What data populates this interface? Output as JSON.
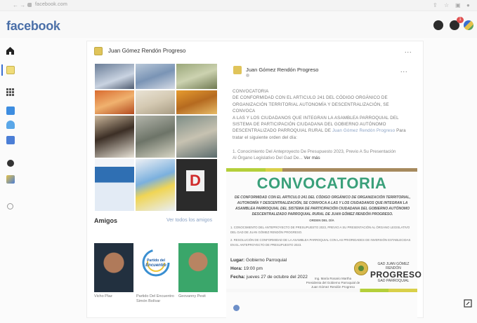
{
  "browser": {
    "url": "facebook.com",
    "nav_glyphs": "←  →  C"
  },
  "header": {
    "logo": "facebook",
    "notification_count": "1"
  },
  "colors": {
    "fb_blue": "#4a6fa8",
    "convocatoria_green": "#3aa07a",
    "link_blue": "#8aa2c4"
  },
  "profile": {
    "name": "Juan Gómez Rendón Progreso",
    "more": "..."
  },
  "amigos": {
    "title": "Amigos",
    "see_all": "Ver todos los amigos",
    "friends": [
      {
        "name": "Vicho Plaz"
      },
      {
        "name": "Partido Del Encuentro Simón Bolívar"
      },
      {
        "name": "Geovanny Pesit"
      }
    ],
    "partido_logo_text_1": "Partido del",
    "partido_logo_text_2": "Encuentro"
  },
  "post": {
    "author": "Juan Gómez Rendón Progreso",
    "more": "...",
    "text_lines": [
      "CONVOCATORIA",
      "DE CONFORMIDAD CON EL ARTICULO 241 DEL CÓDIGO ORGÁNICO DE",
      "ORGANIZACIÓN TERRITORIAL AUTONOMÍA Y DESCENTRALIZACIÓN, SE CONVOCA",
      "A LAS Y LOS CIUDADANOS QUE INTEGRAN LA ASAMBLEA PARROQUIAL DEL",
      "SISTEMA DE PARTICIPACIÓN CIUDADANA DEL GOBIERNO AUTÓNOMO",
      "DESCENTRALIZADO PARROQUIAL RURAL DE"
    ],
    "text_link": "Juan Gómez Rendón Progreso",
    "text_tail": "Para",
    "text_last": "tratar el siguiente orden del día:",
    "item_line_1": "1. Conocimiento Del Anteproyecto De Presupuesto 2023, Previo A Su Presentación",
    "item_line_2": "Al Órgano Legislativo Del Gad De...",
    "see_more": "Ver más"
  },
  "flyer": {
    "title": "CONVOCATORIA",
    "body": "DE CONFORMIDAD CON EL ARTICULO 241 DEL CÓDIGO ORGÁNICO DE ORGANIZACIÓN TERRITORIAL, AUTONOMÍA Y DESCENTRALIZACIÓN, SE CONVOCA A LAS Y LOS CIUDADANOS QUE INTEGRAN LA ASAMBLEA PARROQUIAL DEL SISTEMA DE PARTICIPACIÓN CIUDADANA DEL GOBIERNO AUTÓNOMO DESCENTRALIZADO PARROQUIAL RURAL DE JUAN GÓMEZ RENDÓN PROGRESO.",
    "orden": "ORDEN DEL DÍA",
    "item_1": "1.  CONOCIMIENTO DEL ANTEPROYECTO DE PRESUPUESTO 2023, PREVIO A SU PRESENTACIÓN AL ÓRGANO LEGISLATIVO DEL GAD DE JUAN GÓMEZ RENDÓN PROGRESO.",
    "item_2": "2.  RESOLUCIÓN DE CONFORMIDAD DE LA ASAMBLEA PARROQUIAL CON LAS PRIORIDADES DE INVERSIÓN ESTABLECIDAS EN EL ANTEPROYECTO DE PRESUPUESTO 2023.",
    "lugar_label": "Lugar:",
    "lugar_value": "Gobierno Parroquial",
    "hora_label": "Hora:",
    "hora_value": "19:00 pm",
    "fecha_label": "Fecha:",
    "fecha_value": "jueves 27 de octubre del 2022",
    "sig_name": "Ing. María Rosario Martha",
    "sig_role": "Presidenta del Gobierno Parroquial de Juan Gómez Rendón Progreso",
    "gov_line1": "GAD JUAN GÓMEZ RENDÓN",
    "gov_line2": "PROGRESO",
    "gov_line3": "GAD PARROQUIAL"
  }
}
